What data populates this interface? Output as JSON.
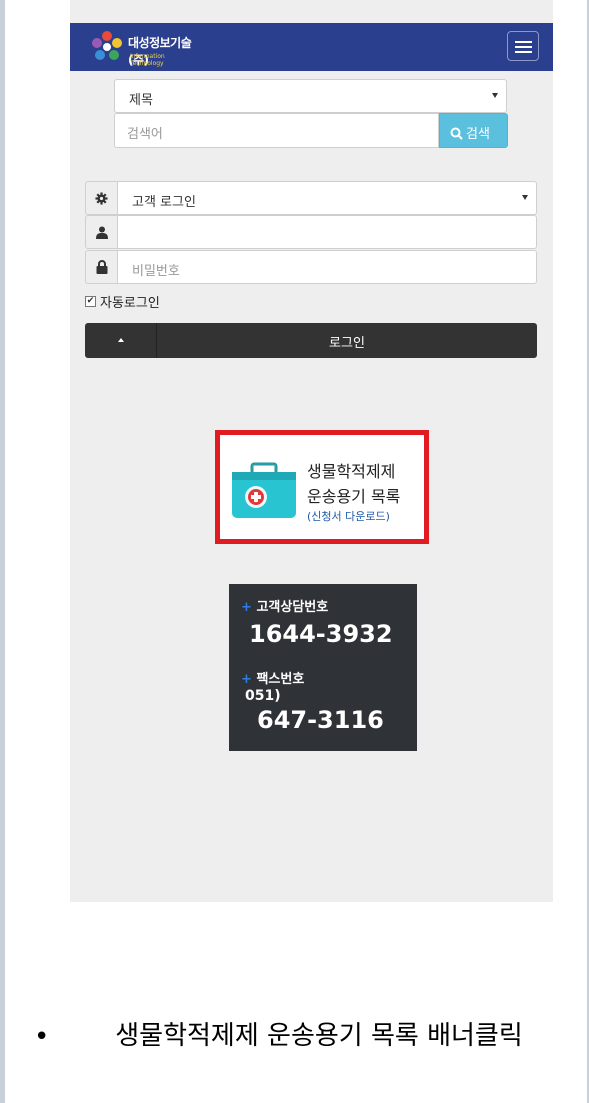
{
  "header": {
    "logo_text": "대성정보기술(주)",
    "logo_subtext": "Information Technology",
    "menu_icon": "hamburger-icon"
  },
  "search": {
    "field_select_value": "제목",
    "placeholder": "검색어",
    "button_label": "검색"
  },
  "login": {
    "type_select_value": "고객 로그인",
    "username_value": "",
    "password_placeholder": "비밀번호",
    "autologin_label": "자동로그인",
    "autologin_checked": true,
    "submit_label": "로그인"
  },
  "banner": {
    "line1": "생물학적제제",
    "line2": "운송용기 목록",
    "line3": "(신청서 다운로드)"
  },
  "contact": {
    "phone_label": "고객상담번호",
    "phone_number": "1644-3932",
    "fax_label": "팩스번호",
    "fax_area": "051)",
    "fax_number": "647-3116"
  },
  "caption": {
    "text": "생물학적제제 운송용기 목록 배너클릭"
  },
  "colors": {
    "header_bg": "#2b3f8f",
    "search_button": "#5bc0de",
    "login_button": "#333333",
    "banner_border": "#e11b22",
    "contact_bg": "#2f3236",
    "accent_plus": "#2f7de1"
  }
}
